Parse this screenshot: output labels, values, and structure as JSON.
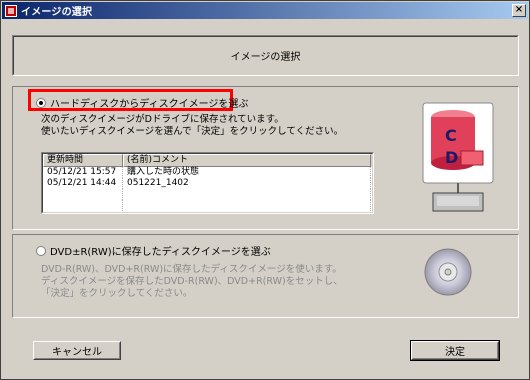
{
  "window": {
    "title": "イメージの選択",
    "close_label": "×"
  },
  "header": {
    "title": "イメージの選択"
  },
  "option_hdd": {
    "label": "ハードディスクからディスクイメージを選ぶ",
    "selected": true,
    "desc_line1": "次のディスクイメージがDドライブに保存されています。",
    "desc_line2": "使いたいディスクイメージを選んで「決定」をクリックしてください。"
  },
  "image_list": {
    "columns": [
      "更新時間",
      "(名前)コメント"
    ],
    "rows": [
      {
        "time": "05/12/21 15:57",
        "name": "購入した時の状態"
      },
      {
        "time": "05/12/21 14:44",
        "name": "051221_1402"
      }
    ]
  },
  "option_dvd": {
    "label": "DVD±R(RW)に保存したディスクイメージを選ぶ",
    "selected": false,
    "desc_line1": "DVD-R(RW)、DVD+R(RW)に保存したディスクイメージを使います。",
    "desc_line2": "ディスクイメージを保存したDVD-R(RW)、DVD+R(RW)をセットし、",
    "desc_line3": "「決定」をクリックしてください。"
  },
  "illustration": {
    "drive_letters": [
      "C",
      "D"
    ]
  },
  "buttons": {
    "cancel": "キャンセル",
    "ok": "決定"
  },
  "colors": {
    "highlight": "#ff0000",
    "drive_red": "#e0405a",
    "titlebar": "#0a246a"
  }
}
